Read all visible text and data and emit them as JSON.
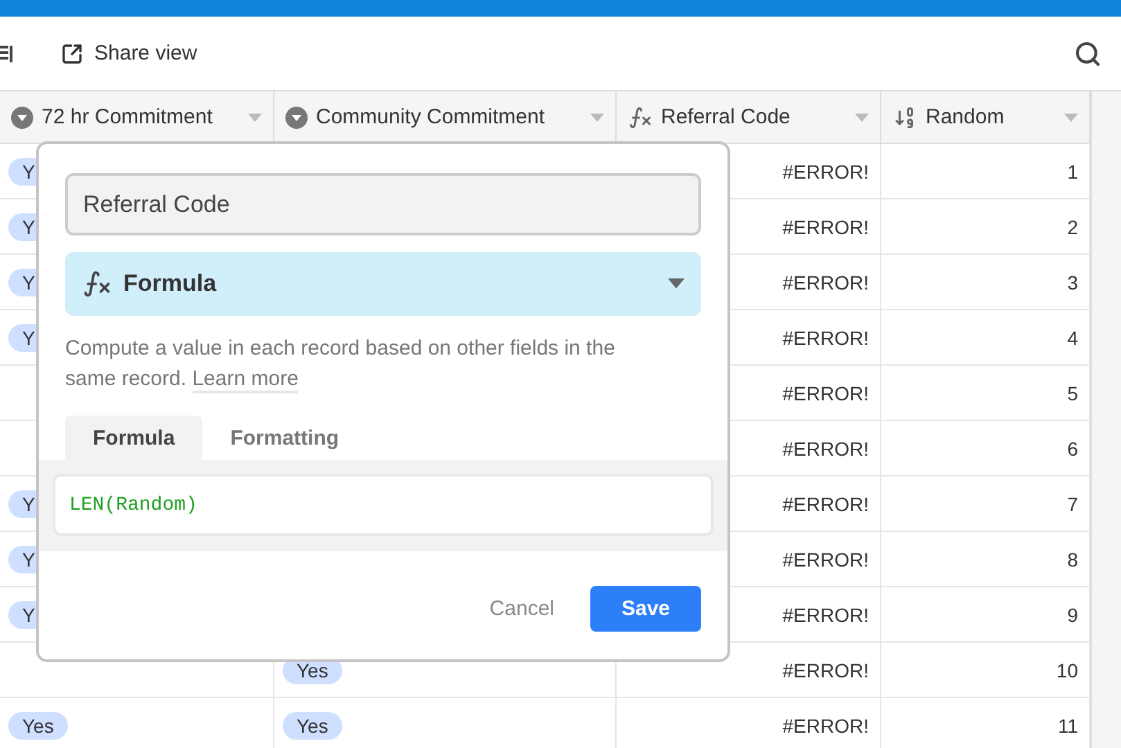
{
  "toolbar": {
    "share_label": "Share view"
  },
  "table": {
    "columns": [
      {
        "label": "72 hr Commitment",
        "kind": "select"
      },
      {
        "label": "Community Commitment",
        "kind": "select"
      },
      {
        "label": "Referral Code",
        "kind": "formula"
      },
      {
        "label": "Random",
        "kind": "number"
      }
    ],
    "rows": [
      {
        "cells": [
          "Y",
          null,
          "#ERROR!",
          "1"
        ]
      },
      {
        "cells": [
          "Y",
          null,
          "#ERROR!",
          "2"
        ]
      },
      {
        "cells": [
          "Y",
          null,
          "#ERROR!",
          "3"
        ]
      },
      {
        "cells": [
          "Y",
          null,
          "#ERROR!",
          "4"
        ]
      },
      {
        "cells": [
          null,
          null,
          "#ERROR!",
          "5"
        ]
      },
      {
        "cells": [
          null,
          null,
          "#ERROR!",
          "6"
        ]
      },
      {
        "cells": [
          "Y",
          null,
          "#ERROR!",
          "7"
        ]
      },
      {
        "cells": [
          "Y",
          null,
          "#ERROR!",
          "8"
        ]
      },
      {
        "cells": [
          "Y",
          null,
          "#ERROR!",
          "9"
        ]
      },
      {
        "cells": [
          null,
          "Yes",
          "#ERROR!",
          "10"
        ]
      },
      {
        "cells": [
          "Yes",
          "Yes",
          "#ERROR!",
          "11"
        ]
      }
    ]
  },
  "dialog": {
    "name_value": "Referral Code",
    "type_label": "Formula",
    "description": "Compute a value in each record based on other fields in the same record.",
    "learn_more": "Learn more",
    "tabs": [
      {
        "label": "Formula",
        "selected": true
      },
      {
        "label": "Formatting",
        "selected": false
      }
    ],
    "formula": "LEN(Random)",
    "cancel": "Cancel",
    "save": "Save"
  }
}
